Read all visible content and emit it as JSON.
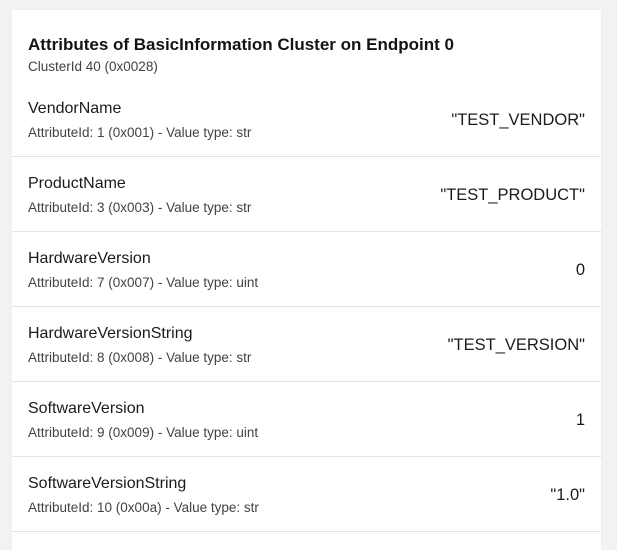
{
  "cluster": {
    "title": "Attributes of BasicInformation Cluster on Endpoint 0",
    "subtitle": "ClusterId 40 (0x0028)"
  },
  "attributes": [
    {
      "name": "VendorName",
      "meta": "AttributeId: 1 (0x001) - Value type: str",
      "value": "\"TEST_VENDOR\""
    },
    {
      "name": "ProductName",
      "meta": "AttributeId: 3 (0x003) - Value type: str",
      "value": "\"TEST_PRODUCT\""
    },
    {
      "name": "HardwareVersion",
      "meta": "AttributeId: 7 (0x007) - Value type: uint",
      "value": "0"
    },
    {
      "name": "HardwareVersionString",
      "meta": "AttributeId: 8 (0x008) - Value type: str",
      "value": "\"TEST_VERSION\""
    },
    {
      "name": "SoftwareVersion",
      "meta": "AttributeId: 9 (0x009) - Value type: uint",
      "value": "1"
    },
    {
      "name": "SoftwareVersionString",
      "meta": "AttributeId: 10 (0x00a) - Value type: str",
      "value": "\"1.0\""
    }
  ]
}
